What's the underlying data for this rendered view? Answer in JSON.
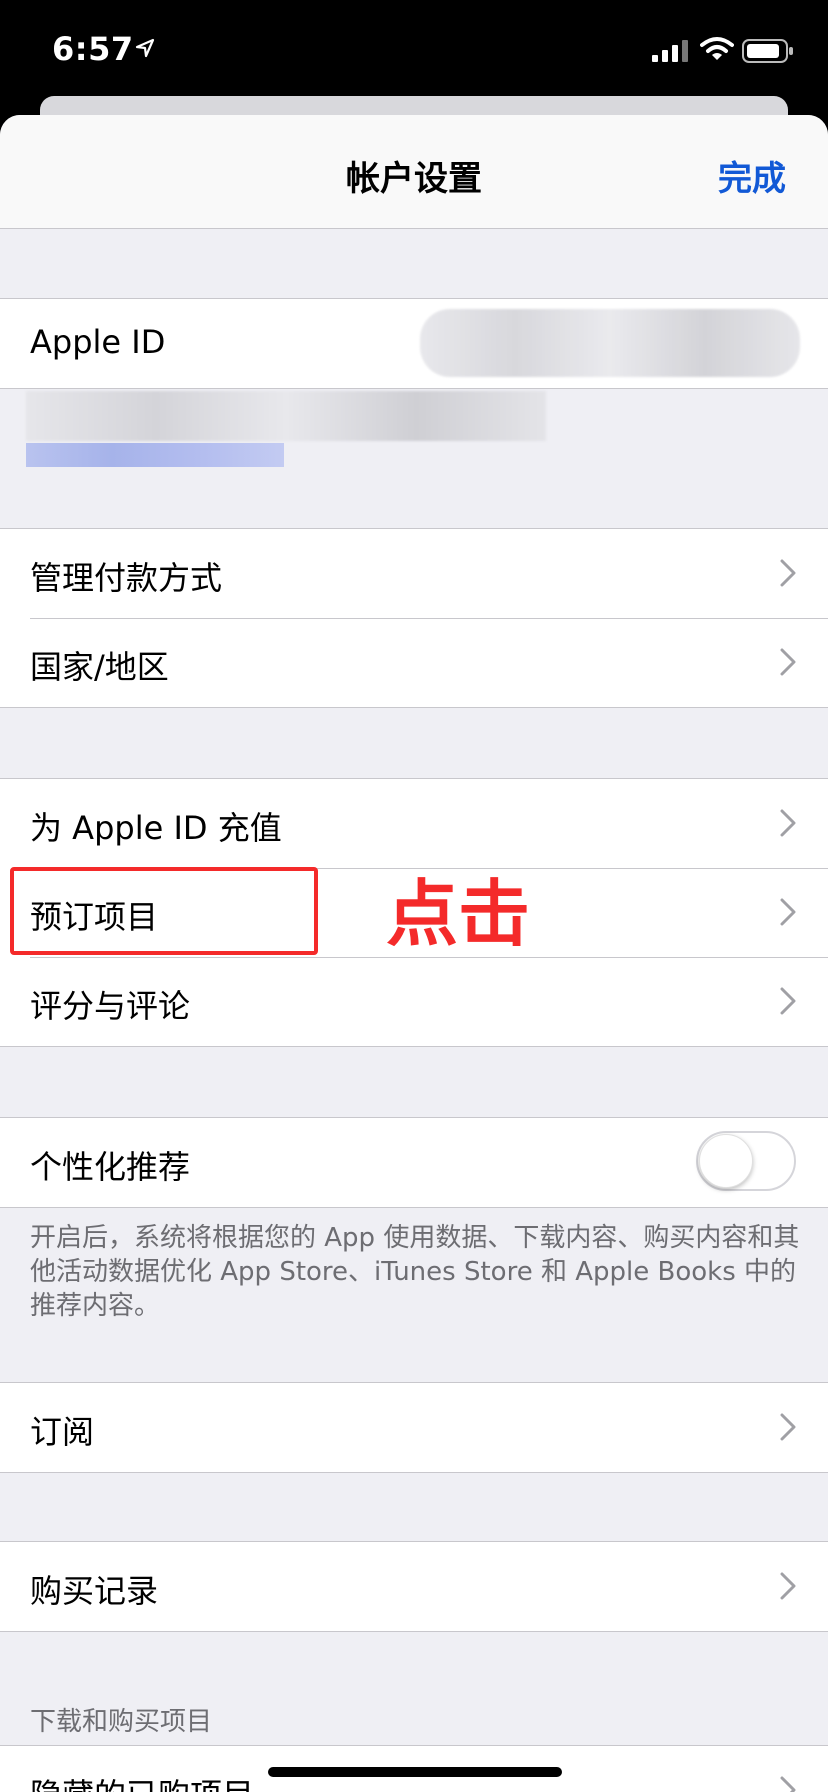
{
  "status_bar": {
    "time": "6:57"
  },
  "navbar": {
    "title": "帐户设置",
    "done_label": "完成"
  },
  "apple_id": {
    "label": "Apple ID"
  },
  "payment_group": [
    {
      "label": "管理付款方式"
    },
    {
      "label": "国家/地区"
    }
  ],
  "actions_group": [
    {
      "label": "为 Apple ID 充值"
    },
    {
      "label": "预订项目"
    },
    {
      "label": "评分与评论"
    }
  ],
  "annotation": {
    "text": "点击",
    "color": "#f42a2a"
  },
  "personalized": {
    "label": "个性化推荐",
    "enabled": false,
    "footnote": "开启后，系统将根据您的 App 使用数据、下载内容、购买内容和其他活动数据优化 App Store、iTunes Store 和 Apple Books 中的推荐内容。"
  },
  "subscriptions": {
    "label": "订阅"
  },
  "purchase_history": {
    "label": "购买记录"
  },
  "downloads_section": {
    "header": "下载和购买项目",
    "partial_row_label": "隐藏的已购项目"
  },
  "colors": {
    "accent": "#1259d6",
    "annotation": "#f42a2a",
    "background": "#efeff4"
  }
}
